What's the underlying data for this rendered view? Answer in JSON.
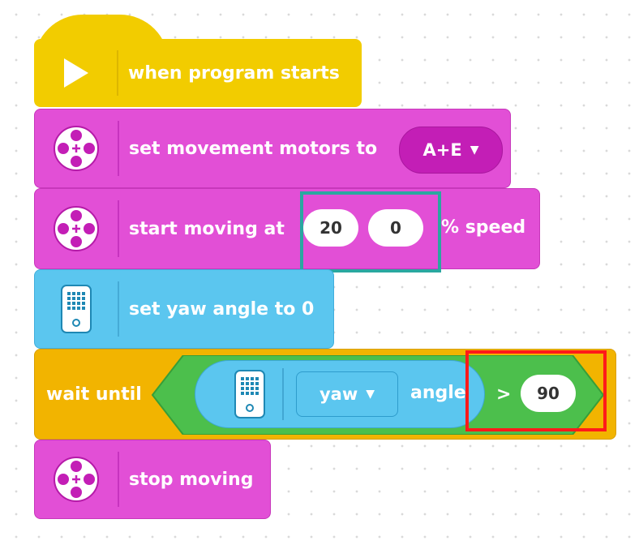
{
  "program": {
    "hat": {
      "label": "when program starts",
      "icon": "play-icon"
    },
    "set_motors": {
      "label": "set movement motors to",
      "value": "A+E",
      "icon": "motor-icon"
    },
    "start_moving": {
      "label_prefix": "start moving at",
      "steering": "20",
      "speed": "0",
      "label_suffix": "% speed",
      "icon": "motor-icon"
    },
    "set_yaw": {
      "label": "set yaw angle to 0",
      "icon": "hub-icon"
    },
    "wait_until": {
      "label": "wait until",
      "sensor_icon": "hub-icon",
      "sensor_option": "yaw",
      "sensor_suffix": "angle",
      "operator": ">",
      "threshold": "90"
    },
    "stop_moving": {
      "label": "stop moving",
      "icon": "motor-icon"
    }
  },
  "colors": {
    "event_yellow": "#f2cc00",
    "motor_pink": "#e24fd6",
    "hub_blue": "#5bc6ef",
    "control_orange": "#f2b400",
    "operator_green": "#4cbf4c",
    "highlight_teal": "#2aa7a0",
    "highlight_red": "#ff1a1a"
  }
}
